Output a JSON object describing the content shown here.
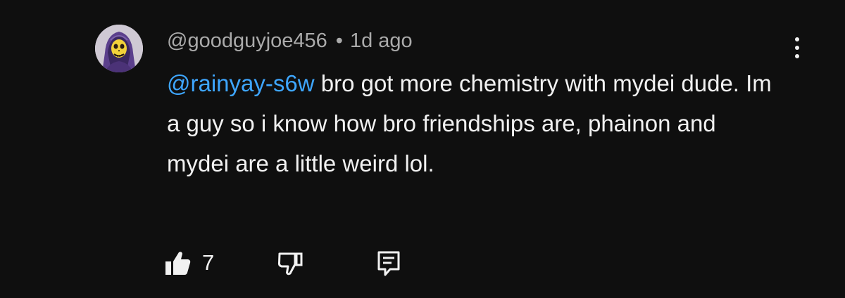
{
  "comment": {
    "author": "@goodguyjoe456",
    "separator": "•",
    "timestamp": "1d ago",
    "mention": "@rainyay-s6w",
    "text": " bro got more chemistry with mydei dude. Im a guy so i know how bro friendships are, phainon and mydei are a little weird lol.",
    "like_count": "7"
  },
  "icons": {
    "avatar": "skeletor-avatar",
    "more": "more-vert-icon",
    "like": "thumbs-up-filled-icon",
    "dislike": "thumbs-down-outline-icon",
    "reply": "comment-reply-icon"
  },
  "colors": {
    "background": "#0f0f0f",
    "text": "#f1f1f1",
    "meta": "#aaaaaa",
    "mention": "#3ea6ff"
  }
}
